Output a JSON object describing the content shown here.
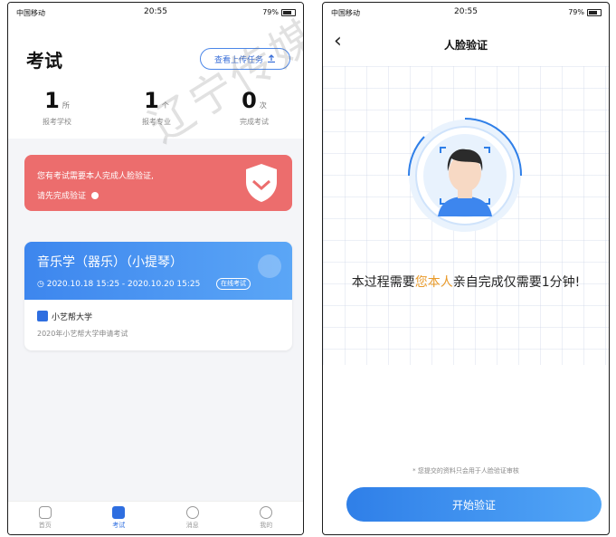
{
  "left_phone": {
    "status": {
      "carrier": "中国移动",
      "time": "20:55",
      "battery": "79%"
    },
    "title": "考试",
    "upload_button": "查看上传任务",
    "stats": [
      {
        "num": "1",
        "unit": "所",
        "label": "报考学校"
      },
      {
        "num": "1",
        "unit": "个",
        "label": "报考专业"
      },
      {
        "num": "0",
        "unit": "次",
        "label": "完成考试"
      }
    ],
    "alert": {
      "line1": "您有考试需要本人完成人脸验证,",
      "line2": "请先完成验证"
    },
    "exam": {
      "title": "音乐学（器乐）（小提琴）",
      "time": "2020.10.18 15:25 - 2020.10.20 15:25",
      "tag": "在线考试",
      "university": "小艺帮大学",
      "subtitle": "2020年小艺帮大学申请考试"
    },
    "tabs": [
      {
        "label": "首页",
        "icon": "home-icon"
      },
      {
        "label": "考试",
        "icon": "exam-icon"
      },
      {
        "label": "消息",
        "icon": "message-icon"
      },
      {
        "label": "我的",
        "icon": "profile-icon"
      }
    ],
    "watermark": "辽宁传媒学院"
  },
  "right_phone": {
    "status": {
      "carrier": "中国移动",
      "time": "20:55",
      "battery": "79%"
    },
    "nav_title": "人脸验证",
    "message_pre": "本过程需要",
    "message_highlight": "您本人",
    "message_post": "亲自完成仅需要1分钟!",
    "notice": "* 您提交的资料只会用于人脸验证审核",
    "start_button": "开始验证"
  }
}
